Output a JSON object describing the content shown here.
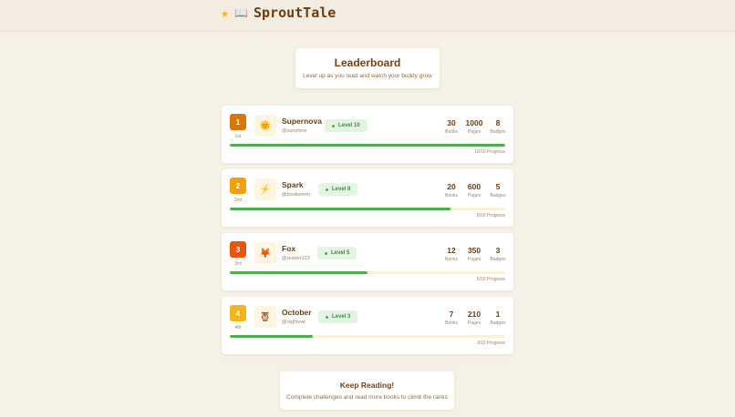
{
  "app": {
    "title": "SproutTale",
    "star_icon": "star-icon",
    "book_icon": "book-icon"
  },
  "hero": {
    "title": "Leaderboard",
    "subtitle": "Level up as you read and watch your buddy grow"
  },
  "leaderboard": [
    {
      "rank": "1",
      "ordinal": "1st",
      "rank_color": "#d97706",
      "avatar_icon": "sun-icon",
      "avatar_glyph": "🌞",
      "name": "Supernova",
      "handle": "@sunshine",
      "level": "Level 10",
      "books": "30",
      "pages": "1000",
      "badges": "8",
      "progress": 1.0,
      "progress_text": "10/10 Progress"
    },
    {
      "rank": "2",
      "ordinal": "2nd",
      "rank_color": "#f59e0b",
      "avatar_icon": "lightning-icon",
      "avatar_glyph": "⚡",
      "name": "Spark",
      "handle": "@bookworm",
      "level": "Level 8",
      "books": "20",
      "pages": "600",
      "badges": "5",
      "progress": 0.8,
      "progress_text": "8/10 Progress"
    },
    {
      "rank": "3",
      "ordinal": "3rd",
      "rank_color": "#e4570c",
      "avatar_icon": "fox-icon",
      "avatar_glyph": "🦊",
      "name": "Fox",
      "handle": "@reader123",
      "level": "Level 5",
      "books": "12",
      "pages": "350",
      "badges": "3",
      "progress": 0.5,
      "progress_text": "5/10 Progress"
    },
    {
      "rank": "4",
      "ordinal": "4th",
      "rank_color": "#f2b51e",
      "avatar_icon": "owl-icon",
      "avatar_glyph": "🦉",
      "name": "October",
      "handle": "@nightowl",
      "level": "Level 3",
      "books": "7",
      "pages": "210",
      "badges": "1",
      "progress": 0.3,
      "progress_text": "3/10 Progress"
    }
  ],
  "stat_labels": {
    "books": "Books",
    "pages": "Pages",
    "badges": "Badges"
  },
  "cta": {
    "title": "Keep Reading!",
    "subtitle": "Complete challenges and read more books to climb the ranks"
  },
  "colors": {
    "accent_green": "#4cae4c",
    "brand_brown": "#6b3d12"
  }
}
